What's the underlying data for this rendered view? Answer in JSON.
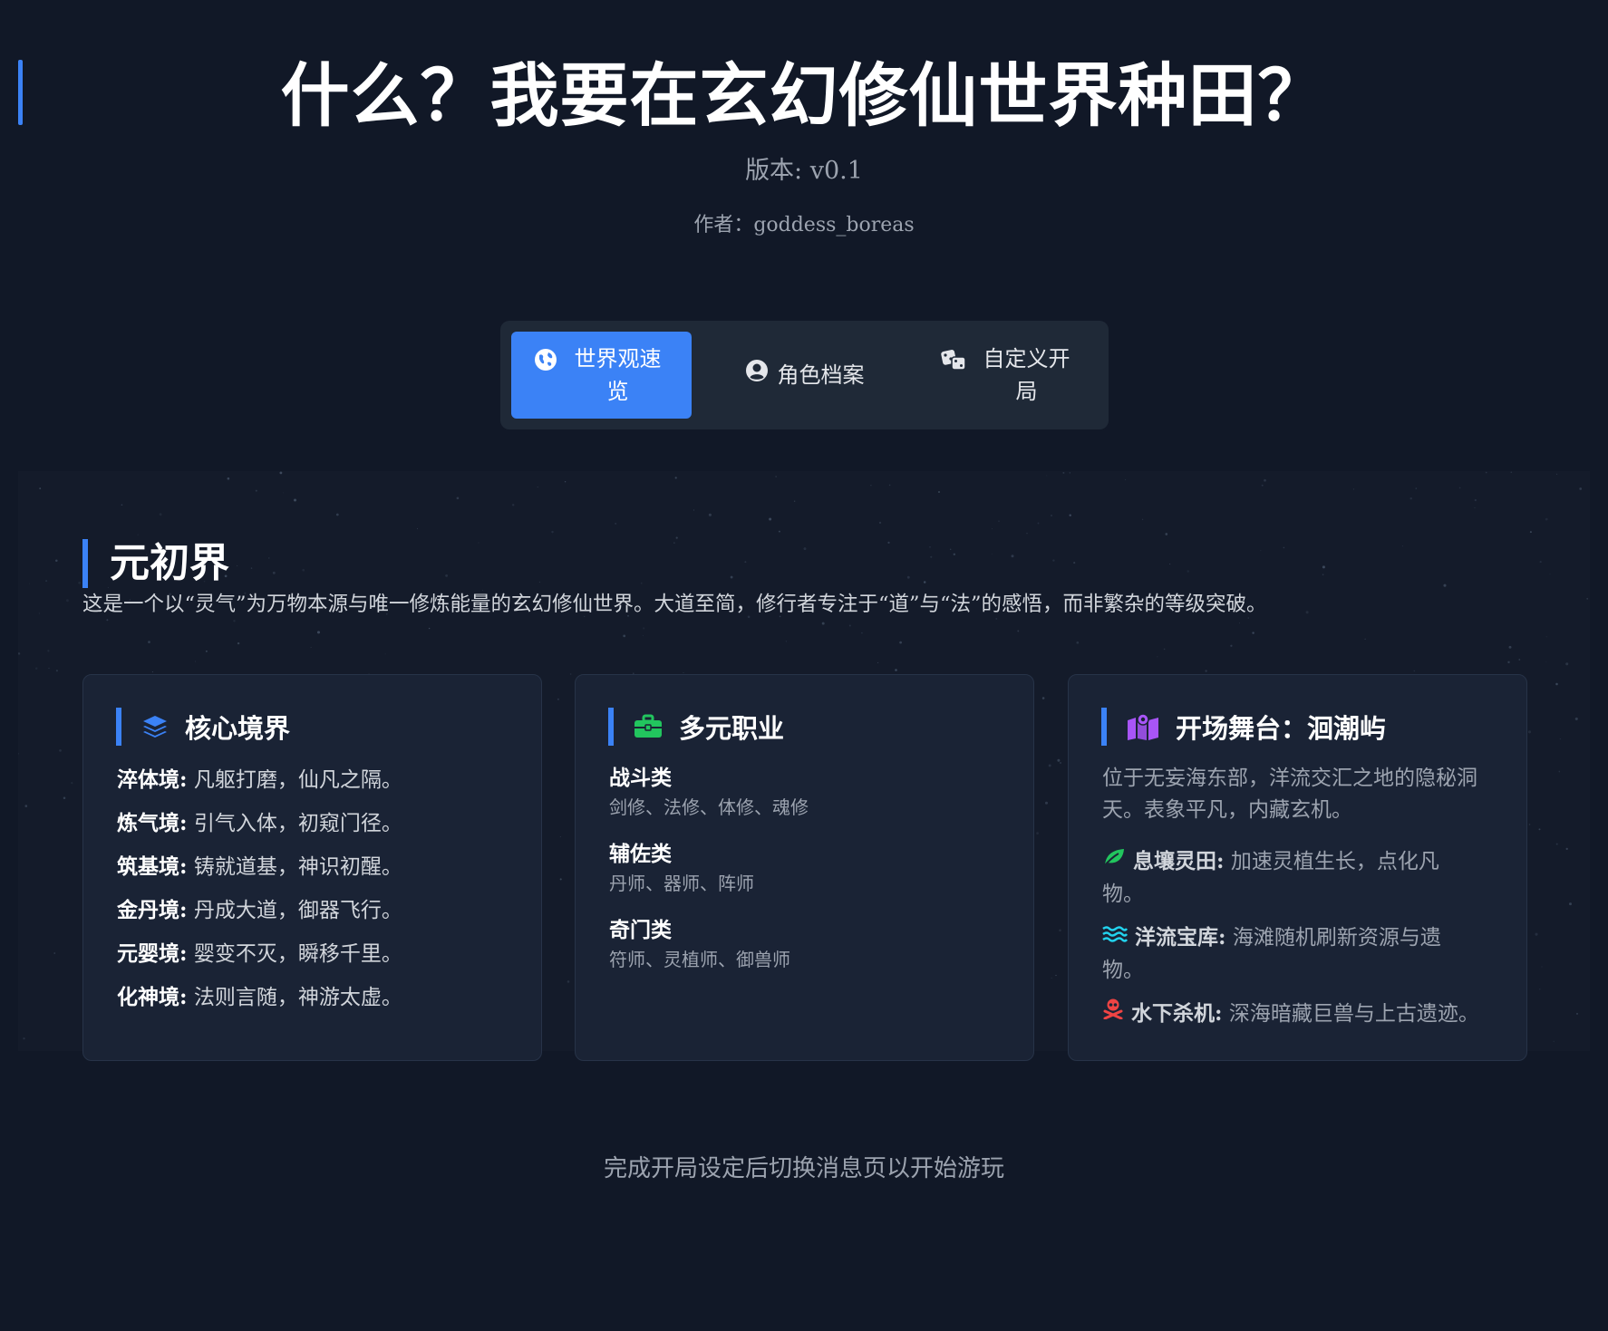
{
  "header": {
    "title": "什么？我要在玄幻修仙世界种田？",
    "version": "版本: v0.1",
    "author": "作者：goddess_boreas"
  },
  "tabs": [
    {
      "label": "世界观速览",
      "icon": "globe-icon",
      "active": true
    },
    {
      "label": "角色档案",
      "icon": "user-circle-icon",
      "active": false
    },
    {
      "label": "自定义开局",
      "icon": "dice-icon",
      "active": false
    }
  ],
  "world": {
    "title": "元初界",
    "description": "这是一个以“灵气”为万物本源与唯一修炼能量的玄幻修仙世界。大道至简，修行者专注于“道”与“法”的感悟，而非繁杂的等级突破。"
  },
  "cards": {
    "realms": {
      "title": "核心境界",
      "icon": "layers-icon",
      "items": [
        {
          "name": "淬体境:",
          "desc": "凡躯打磨，仙凡之隔。"
        },
        {
          "name": "炼气境:",
          "desc": "引气入体，初窥门径。"
        },
        {
          "name": "筑基境:",
          "desc": "铸就道基，神识初醒。"
        },
        {
          "name": "金丹境:",
          "desc": "丹成大道，御器飞行。"
        },
        {
          "name": "元婴境:",
          "desc": "婴变不灭，瞬移千里。"
        },
        {
          "name": "化神境:",
          "desc": "法则言随，神游太虚。"
        }
      ]
    },
    "professions": {
      "title": "多元职业",
      "icon": "briefcase-icon",
      "groups": [
        {
          "name": "战斗类",
          "list": "剑修、法修、体修、魂修"
        },
        {
          "name": "辅佐类",
          "list": "丹师、器师、阵师"
        },
        {
          "name": "奇门类",
          "list": "符师、灵植师、御兽师"
        }
      ]
    },
    "stage": {
      "title": "开场舞台：洄潮屿",
      "icon": "map-icon",
      "description": "位于无妄海东部，洋流交汇之地的隐秘洞天。表象平凡，内藏玄机。",
      "features": [
        {
          "icon": "leaf-icon",
          "color": "#22c55e",
          "name": "息壤灵田:",
          "desc": "加速灵植生长，点化凡物。"
        },
        {
          "icon": "water-icon",
          "color": "#22d3ee",
          "name": "洋流宝库:",
          "desc": "海滩随机刷新资源与遗物。"
        },
        {
          "icon": "skull-icon",
          "color": "#ef4444",
          "name": "水下杀机:",
          "desc": "深海暗藏巨兽与上古遗迹。"
        }
      ]
    }
  },
  "footer": {
    "note": "完成开局设定后切换消息页以开始游玩"
  },
  "colors": {
    "accent": "#3b82f6",
    "background": "#111827",
    "card": "#1a2335"
  }
}
